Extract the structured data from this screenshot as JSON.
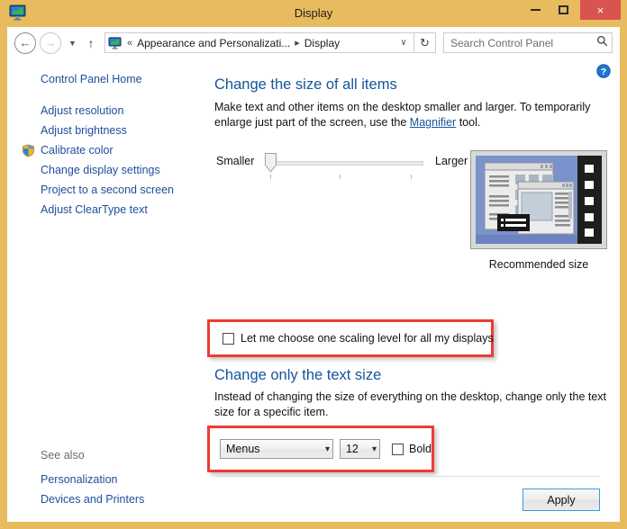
{
  "window": {
    "title": "Display",
    "icon": "display-monitor-icon",
    "frame_color": "#e8bb5e",
    "minimize_label": "Minimize",
    "maximize_label": "Maximize",
    "close_label": "×"
  },
  "nav": {
    "back_glyph": "←",
    "forward_glyph": "→",
    "recent_glyph": "▼",
    "up_glyph": "↑",
    "breadcrumb_separator_start": "«",
    "breadcrumb_separator": "▸",
    "crumbs": [
      "Appearance and Personalizati...",
      "Display"
    ],
    "dropdown_glyph": "∨",
    "refresh_glyph": "↻"
  },
  "search": {
    "placeholder": "Search Control Panel",
    "value": "",
    "icon": "search-icon"
  },
  "sidebar": {
    "home_label": "Control Panel Home",
    "items": [
      {
        "label": "Adjust resolution",
        "shield": false
      },
      {
        "label": "Adjust brightness",
        "shield": false
      },
      {
        "label": "Calibrate color",
        "shield": true
      },
      {
        "label": "Change display settings",
        "shield": false
      },
      {
        "label": "Project to a second screen",
        "shield": false
      },
      {
        "label": "Adjust ClearType text",
        "shield": false
      }
    ],
    "see_also_label": "See also",
    "see_also_items": [
      "Personalization",
      "Devices and Printers"
    ]
  },
  "main": {
    "help_icon": "help-question-icon",
    "section_size": {
      "heading": "Change the size of all items",
      "description_part1": "Make text and other items on the desktop smaller and larger. To temporarily enlarge just part of the screen, use the ",
      "link_text": "Magnifier",
      "description_part2": " tool.",
      "slider_min_label": "Smaller",
      "slider_max_label": "Larger",
      "slider_value": 0,
      "slider_ticks": 3,
      "preview_caption": "Recommended size"
    },
    "scaling_checkbox": {
      "label": "Let me choose one scaling level for all my displays",
      "checked": false
    },
    "section_textsize": {
      "heading": "Change only the text size",
      "description": "Instead of changing the size of everything on the desktop, change only the text size for a specific item.",
      "item_select_value": "Menus",
      "size_select_value": "12",
      "bold_label": "Bold",
      "bold_checked": false
    },
    "apply_label": "Apply"
  },
  "colors": {
    "frame": "#e8bb5e",
    "heading_blue": "#15559a",
    "link_blue": "#1f4e9c",
    "highlight_red": "#ef3b33",
    "close_red": "#d9534f",
    "focus_blue": "#3c9ade"
  }
}
